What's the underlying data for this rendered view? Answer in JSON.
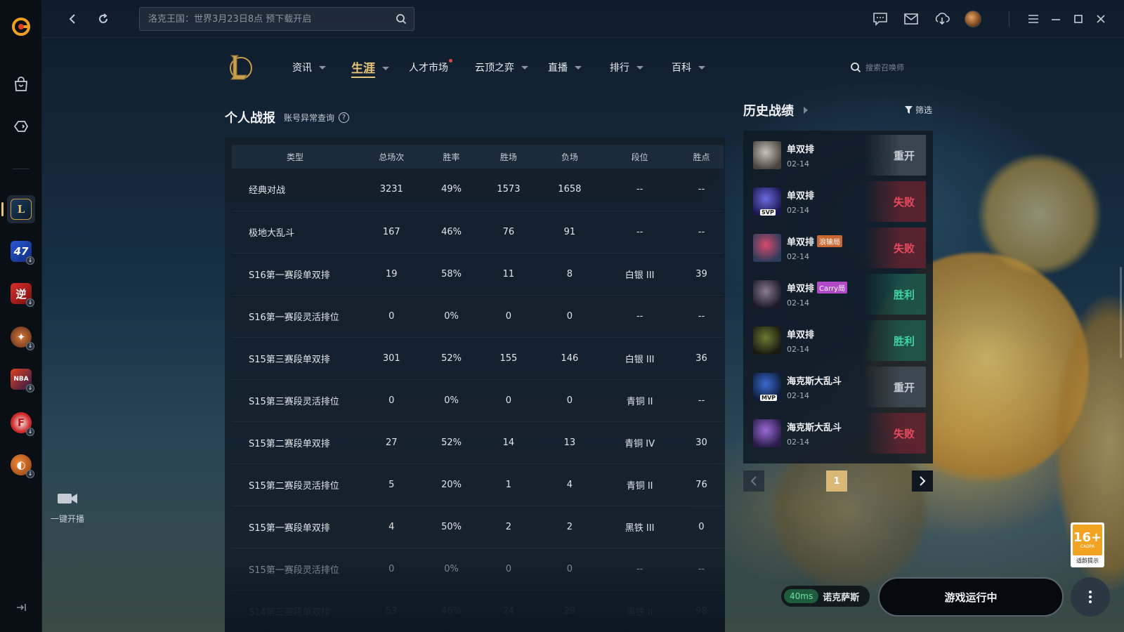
{
  "topbar": {
    "search_placeholder": "洛克王国：世界3月23日8点 预下载开启"
  },
  "game_nav": {
    "items": [
      {
        "label": "资讯",
        "caret": true
      },
      {
        "label": "生涯",
        "caret": true,
        "active": true
      },
      {
        "label": "人才市场",
        "caret": false,
        "dot": true
      },
      {
        "label": "云顶之弈",
        "caret": true
      },
      {
        "label": "直播",
        "caret": true
      },
      {
        "label": "排行",
        "caret": true
      },
      {
        "label": "百科",
        "caret": true
      }
    ],
    "summoner_placeholder": "搜索召唤师"
  },
  "stats": {
    "title": "个人战报",
    "sub_link": "账号异常查询",
    "help": "?",
    "headers": [
      "类型",
      "总场次",
      "胜率",
      "胜场",
      "负场",
      "段位",
      "胜点"
    ],
    "rows": [
      [
        "经典对战",
        "3231",
        "49%",
        "1573",
        "1658",
        "--",
        "--"
      ],
      [
        "极地大乱斗",
        "167",
        "46%",
        "76",
        "91",
        "--",
        "--"
      ],
      [
        "S16第一赛段单双排",
        "19",
        "58%",
        "11",
        "8",
        "白银 III",
        "39"
      ],
      [
        "S16第一赛段灵活排位",
        "0",
        "0%",
        "0",
        "0",
        "--",
        "--"
      ],
      [
        "S15第三赛段单双排",
        "301",
        "52%",
        "155",
        "146",
        "白银 III",
        "36"
      ],
      [
        "S15第三赛段灵活排位",
        "0",
        "0%",
        "0",
        "0",
        "青铜 II",
        "--"
      ],
      [
        "S15第二赛段单双排",
        "27",
        "52%",
        "14",
        "13",
        "青铜 IV",
        "30"
      ],
      [
        "S15第二赛段灵活排位",
        "5",
        "20%",
        "1",
        "4",
        "青铜 II",
        "76"
      ],
      [
        "S15第一赛段单双排",
        "4",
        "50%",
        "2",
        "2",
        "黑铁 III",
        "0"
      ],
      [
        "S15第一赛段灵活排位",
        "0",
        "0%",
        "0",
        "0",
        "--",
        "--"
      ],
      [
        "S14第三赛段单双排",
        "53",
        "46%",
        "24",
        "29",
        "黑铁 II",
        "98"
      ]
    ]
  },
  "history": {
    "title": "历史战绩",
    "filter_label": "筛选",
    "items": [
      {
        "mode": "单双排",
        "date": "02-14",
        "result": "重开",
        "kind": "remake",
        "tag": "",
        "tag_color": "",
        "champ_colors": [
          "#c9c2b8",
          "#4a4440"
        ],
        "badge": ""
      },
      {
        "mode": "单双排",
        "date": "02-14",
        "result": "失败",
        "kind": "loss",
        "tag": "",
        "tag_color": "",
        "champ_colors": [
          "#6b6be0",
          "#1b1850"
        ],
        "badge": "SVP"
      },
      {
        "mode": "单双排",
        "date": "02-14",
        "result": "失败",
        "kind": "loss",
        "tag": "浪输局",
        "tag_color": "#c96a34",
        "champ_colors": [
          "#d94a6a",
          "#2c3c5c"
        ],
        "badge": ""
      },
      {
        "mode": "单双排",
        "date": "02-14",
        "result": "胜利",
        "kind": "win",
        "tag": "Carry局",
        "tag_color": "#b04ac9",
        "champ_colors": [
          "#8a7a90",
          "#1c1a26"
        ],
        "badge": ""
      },
      {
        "mode": "单双排",
        "date": "02-14",
        "result": "胜利",
        "kind": "win",
        "tag": "",
        "tag_color": "",
        "champ_colors": [
          "#6a7a30",
          "#1a1a12"
        ],
        "badge": ""
      },
      {
        "mode": "海克斯大乱斗",
        "date": "02-14",
        "result": "重开",
        "kind": "remake",
        "tag": "",
        "tag_color": "",
        "champ_colors": [
          "#3a6ad0",
          "#0e1c3a"
        ],
        "badge": "MVP"
      },
      {
        "mode": "海克斯大乱斗",
        "date": "02-14",
        "result": "失败",
        "kind": "loss",
        "tag": "",
        "tag_color": "",
        "champ_colors": [
          "#9a6ad8",
          "#2a1c48"
        ],
        "badge": ""
      }
    ],
    "page": "1"
  },
  "bottom": {
    "stream_label": "一键开播",
    "ping": "40ms",
    "server": "诺克萨斯",
    "launch_label": "游戏运行中",
    "age_number": "16+",
    "age_small": "CADPA",
    "age_tip": "适龄提示"
  },
  "colors": {
    "accent": "#e8c37a",
    "win": "#3fd6a4",
    "loss": "#e84a5f"
  }
}
